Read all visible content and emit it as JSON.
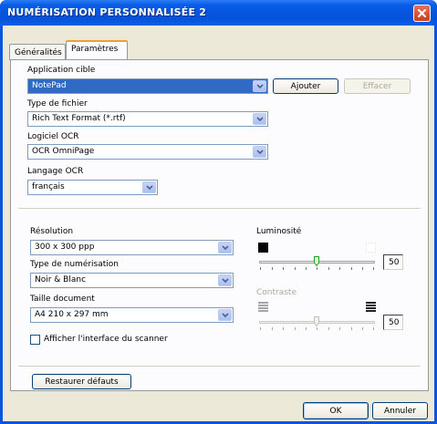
{
  "window": {
    "title": "NUMÉRISATION PERSONNALISÉE 2"
  },
  "tabs": [
    {
      "label": "Généralités",
      "active": false
    },
    {
      "label": "Paramètres",
      "active": true
    }
  ],
  "target_app": {
    "label": "Application cible",
    "value": "NotePad",
    "add_button": "Ajouter",
    "clear_button": "Effacer"
  },
  "file_type": {
    "label": "Type de fichier",
    "value": "Rich Text Format (*.rtf)"
  },
  "ocr_software": {
    "label": "Logiciel OCR",
    "value": "OCR OmniPage"
  },
  "ocr_language": {
    "label": "Langage OCR",
    "value": "français"
  },
  "resolution": {
    "label": "Résolution",
    "value": "300 x 300 ppp"
  },
  "scan_type": {
    "label": "Type de numérisation",
    "value": "Noir & Blanc"
  },
  "document_size": {
    "label": "Taille document",
    "value": "A4 210 x 297 mm"
  },
  "show_scanner_interface": {
    "label": "Afficher l'interface du scanner",
    "checked": false
  },
  "brightness": {
    "label": "Luminosité",
    "value": "50",
    "enabled": true
  },
  "contrast": {
    "label": "Contraste",
    "value": "50",
    "enabled": false
  },
  "restore_button": "Restaurer défauts",
  "ok_button": "OK",
  "cancel_button": "Annuler",
  "colors": {
    "titlebar": "#0452d8",
    "dialog_bg": "#ece9d8",
    "selection": "#316ac5"
  }
}
